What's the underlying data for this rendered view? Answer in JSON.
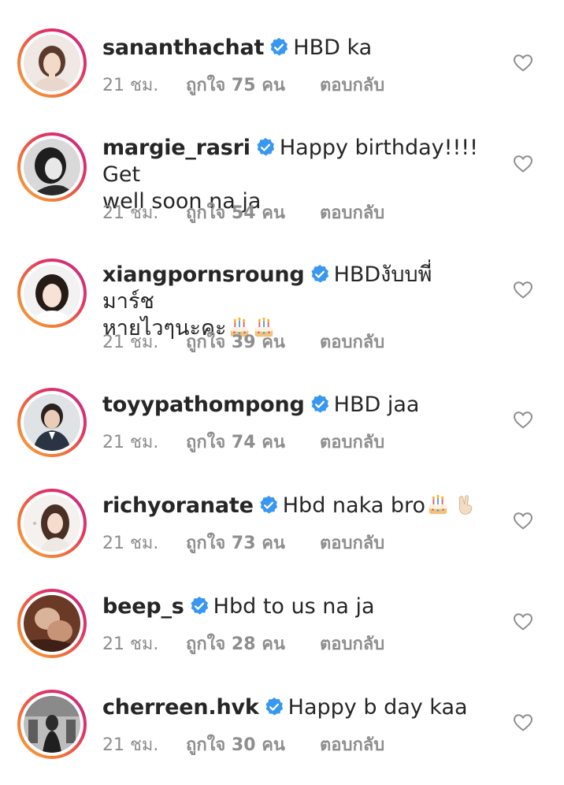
{
  "colors": {
    "text": "#262626",
    "meta": "#8e8e8e",
    "verified": "#3897f0",
    "ring_start": "#f9a73b",
    "ring_end": "#c22a8d"
  },
  "icons": {
    "verified": "verified-badge-icon",
    "like": "heart-outline-icon",
    "birthday": "birthday-cake-emoji",
    "peace": "victory-hand-emoji"
  },
  "comments": [
    {
      "username": "sananthachat",
      "text_line1": "HBD ka",
      "text_line2": "",
      "time": "21 ชม.",
      "likes": "ถูกใจ 75 คน",
      "reply": "ตอบกลับ"
    },
    {
      "username": "margie_rasri",
      "text_line1": "Happy birthday!!!! Get",
      "text_line2": "well soon na ja",
      "time": "21 ชม.",
      "likes": "ถูกใจ 54 คน",
      "reply": "ตอบกลับ"
    },
    {
      "username": "xiangpornsroung",
      "text_line1": "HBDงับบพี่มาร์ช",
      "text_line2": "หายไวๆนะคะ",
      "time": "21 ชม.",
      "likes": "ถูกใจ 39 คน",
      "reply": "ตอบกลับ"
    },
    {
      "username": "toyypathompong",
      "text_line1": "HBD jaa",
      "text_line2": "",
      "time": "21 ชม.",
      "likes": "ถูกใจ 74 คน",
      "reply": "ตอบกลับ"
    },
    {
      "username": "richyoranate",
      "text_line1": "Hbd naka bro",
      "text_line2": "",
      "time": "21 ชม.",
      "likes": "ถูกใจ 73 คน",
      "reply": "ตอบกลับ"
    },
    {
      "username": "beep_s",
      "text_line1": "Hbd to us na ja",
      "text_line2": "",
      "time": "21 ชม.",
      "likes": "ถูกใจ 28 คน",
      "reply": "ตอบกลับ"
    },
    {
      "username": "cherreen.hvk",
      "text_line1": "Happy b day kaa",
      "text_line2": "",
      "time": "21 ชม.",
      "likes": "ถูกใจ 30 คน",
      "reply": "ตอบกลับ"
    }
  ]
}
